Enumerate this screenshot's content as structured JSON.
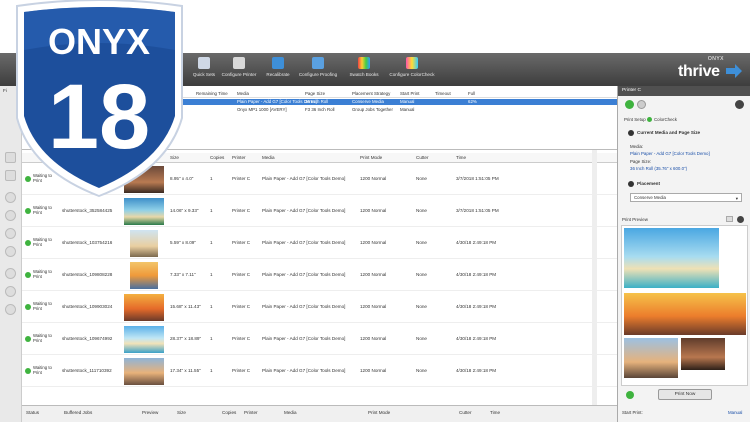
{
  "app": {
    "logo_word": "ONYX",
    "logo_number": "18",
    "menu_stub": "Fi"
  },
  "toolbar": {
    "buttons": [
      {
        "label": "Quick Sets",
        "icon": "quick-sets-icon"
      },
      {
        "label": "Configure Printer",
        "icon": "printer-icon"
      },
      {
        "label": "Recalibrate",
        "icon": "recalibrate-icon"
      },
      {
        "label": "Configure Proofing",
        "icon": "proofing-icon"
      },
      {
        "label": "Swatch Books",
        "icon": "swatch-books-icon"
      },
      {
        "label": "Configure ColorCheck",
        "icon": "colorcheck-icon"
      }
    ],
    "brand_small": "ONYX",
    "brand_big": "thrive"
  },
  "upper_queue": {
    "headers": {
      "remaining_time": "Remaining Time",
      "media": "Media",
      "page_size": "Page Size",
      "placement_strategy": "Placement Strategy",
      "start_print": "Start Print",
      "timeout": "Timeout",
      "full": "Full"
    },
    "rows": [
      {
        "media": "Plain Paper - Add G7 [Color Tools Demo]",
        "page_size": "36 Inch Roll",
        "placement": "Conserve Media",
        "start": "Manual",
        "full": "62%",
        "selected": true
      },
      {
        "media": "Onyx MP1 1000 [AVERY]",
        "page_size": "F3 36 Inch Roll",
        "placement": "Group Jobs Together",
        "start": "Manual",
        "full": "",
        "selected": false
      }
    ]
  },
  "lower_queue": {
    "headers": {
      "size": "Size",
      "copies": "Copies",
      "printer": "Printer",
      "media": "Media",
      "print_mode": "Print Mode",
      "cutter": "Cutter",
      "time": "Time"
    },
    "rows": [
      {
        "status": "Waiting to Print",
        "name": "",
        "size": "8.95\" x 4.0\"",
        "copies": "1",
        "printer": "Printer C",
        "media": "Plain Paper - Add G7 [Color Tools Demo]",
        "mode": "1200 Normal",
        "cutter": "None",
        "time": "3/7/2018 1:51:05 PM"
      },
      {
        "status": "Waiting to Print",
        "name": "shutterstock_352584425",
        "size": "14.06\" x 9.33\"",
        "copies": "1",
        "printer": "Printer C",
        "media": "Plain Paper - Add G7 [Color Tools Demo]",
        "mode": "1200 Normal",
        "cutter": "None",
        "time": "3/7/2018 1:51:05 PM"
      },
      {
        "status": "Waiting to Print",
        "name": "shutterstock_103754216",
        "size": "5.59\" x 8.09\"",
        "copies": "1",
        "printer": "Printer C",
        "media": "Plain Paper - Add G7 [Color Tools Demo]",
        "mode": "1200 Normal",
        "cutter": "None",
        "time": "4/30/18 2:49:18 PM"
      },
      {
        "status": "Waiting to Print",
        "name": "shutterstock_109808228",
        "size": "7.33\" x 7.11\"",
        "copies": "1",
        "printer": "Printer C",
        "media": "Plain Paper - Add G7 [Color Tools Demo]",
        "mode": "1200 Normal",
        "cutter": "None",
        "time": "4/30/18 2:49:18 PM"
      },
      {
        "status": "Waiting to Print",
        "name": "shutterstock_109903024",
        "size": "15.68\" x 11.43\"",
        "copies": "1",
        "printer": "Printer C",
        "media": "Plain Paper - Add G7 [Color Tools Demo]",
        "mode": "1200 Normal",
        "cutter": "None",
        "time": "4/30/18 2:49:18 PM"
      },
      {
        "status": "Waiting to Print",
        "name": "shutterstock_109674992",
        "size": "28.37\" x 18.89\"",
        "copies": "1",
        "printer": "Printer C",
        "media": "Plain Paper - Add G7 [Color Tools Demo]",
        "mode": "1200 Normal",
        "cutter": "None",
        "time": "4/30/18 2:49:18 PM"
      },
      {
        "status": "Waiting to Print",
        "name": "shutterstock_111710392",
        "size": "17.34\" x 11.55\"",
        "copies": "1",
        "printer": "Printer C",
        "media": "Plain Paper - Add G7 [Color Tools Demo]",
        "mode": "1200 Normal",
        "cutter": "None",
        "time": "4/30/18 2:49:18 PM"
      }
    ]
  },
  "footer": {
    "status": "Status",
    "buffered": "Buffered Jobs",
    "preview": "Preview",
    "size": "Size",
    "copies": "Copies",
    "printer": "Printer",
    "media": "Media",
    "print_mode": "Print Mode",
    "cutter": "Cutter",
    "time": "Time"
  },
  "right_panel": {
    "title": "Printer C",
    "print_setup": "Print Setup",
    "colorcheck": "ColorCheck",
    "section_media": "Current Media and Page Size",
    "media_label": "Media:",
    "media_value": "Plain Paper - Add G7 [Color Tools Demo]",
    "page_size_label": "Page Size:",
    "page_size_value": "36 Inch Roll (35.76\" x 600.0\")",
    "section_placement": "Placement",
    "placement_value": "Conserve Media",
    "print_preview": "Print Preview",
    "print_now": "Print Now",
    "start_print_label": "Start Print:",
    "start_print_value": "Manual"
  },
  "colors": {
    "toolbar_dark": "#3d3d3d",
    "selection": "#3b7fd4",
    "logo_blue": "#1d4f9c",
    "status_green": "#3fb33f"
  }
}
